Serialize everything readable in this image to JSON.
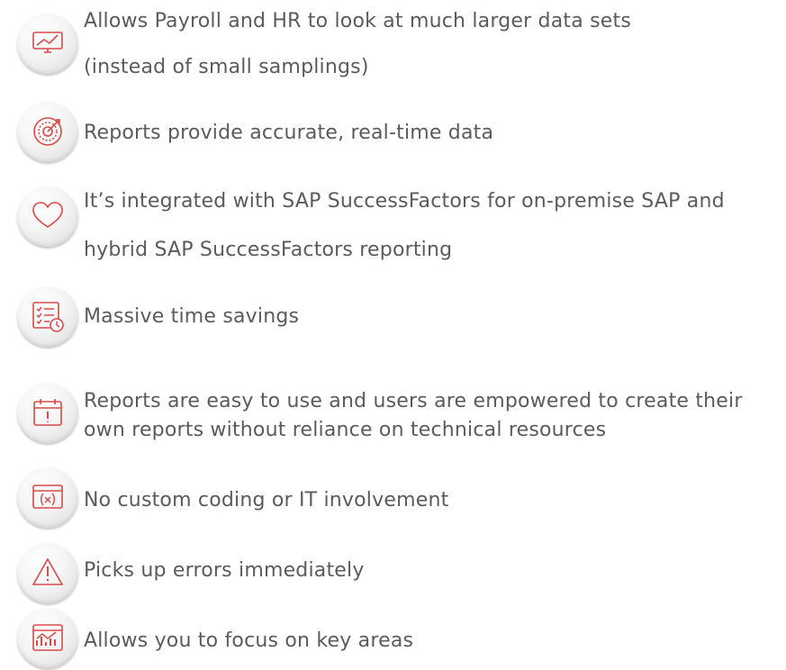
{
  "items": [
    {
      "line1": "Allows Payroll and HR to look at much larger data sets",
      "line2": "(instead of small samplings)",
      "icon": "monitor-chart-icon"
    },
    {
      "line1": "Reports provide accurate, real-time data",
      "icon": "target-icon"
    },
    {
      "line1": "It’s integrated with SAP SuccessFactors for on-premise SAP and",
      "line2": "hybrid SAP SuccessFactors reporting",
      "icon": "heart-icon"
    },
    {
      "line1": "Massive time savings",
      "icon": "checklist-clock-icon"
    },
    {
      "line1": "Reports are easy to use and users are empowered to create their",
      "line2": "own reports without reliance on technical resources",
      "icon": "calendar-alert-icon"
    },
    {
      "line1": "No custom coding or IT involvement",
      "icon": "code-window-icon"
    },
    {
      "line1": "Picks up errors immediately",
      "icon": "warning-icon"
    },
    {
      "line1": "Allows you to focus on key areas",
      "icon": "dashboard-chart-icon"
    }
  ],
  "colors": {
    "text": "#5b5b5b",
    "icon": "#d94a4a",
    "badge": "#f4f4f4"
  }
}
